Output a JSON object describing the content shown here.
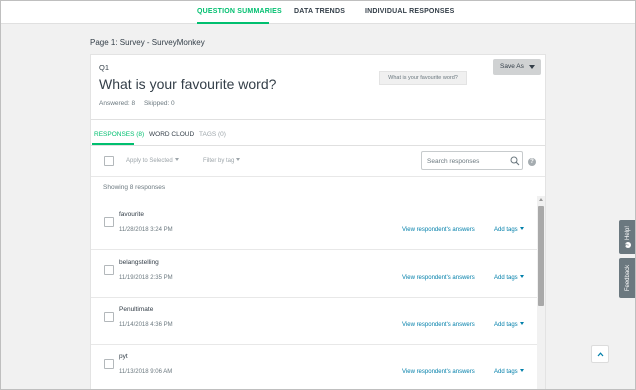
{
  "top_nav": {
    "tabs": [
      {
        "label": "QUESTION SUMMARIES",
        "active": true
      },
      {
        "label": "DATA TRENDS",
        "active": false
      },
      {
        "label": "INDIVIDUAL RESPONSES",
        "active": false
      }
    ]
  },
  "page": {
    "title": "Page 1: Survey - SurveyMonkey"
  },
  "question": {
    "number": "Q1",
    "title": "What is your favourite word?",
    "answered": "Answered: 8",
    "skipped": "Skipped: 0",
    "tooltip": "What is your favourite word?",
    "save_as_label": "Save As"
  },
  "subtabs": [
    {
      "label": "RESPONSES (8)",
      "state": "active"
    },
    {
      "label": "WORD CLOUD",
      "state": "normal"
    },
    {
      "label": "TAGS (0)",
      "state": "muted"
    }
  ],
  "toolbar": {
    "apply_label": "Apply to Selected",
    "filter_label": "Filter by tag",
    "search_placeholder": "Search responses",
    "help_glyph": "?"
  },
  "showing_text": "Showing 8 responses",
  "responses": [
    {
      "text": "favourite",
      "date": "11/28/2018 3:24 PM",
      "view_label": "View respondent's answers",
      "tags_label": "Add tags"
    },
    {
      "text": "belangstelling",
      "date": "11/19/2018 2:35 PM",
      "view_label": "View respondent's answers",
      "tags_label": "Add tags"
    },
    {
      "text": "Penultimate",
      "date": "11/14/2018 4:36 PM",
      "view_label": "View respondent's answers",
      "tags_label": "Add tags"
    },
    {
      "text": "pyt",
      "date": "11/13/2018 9:06 AM",
      "view_label": "View respondent's answers",
      "tags_label": "Add tags"
    }
  ],
  "side_tabs": {
    "help": "Help!",
    "feedback": "Feedback"
  },
  "colors": {
    "accent": "#00bf6f",
    "link": "#007faa",
    "text": "#333e48",
    "muted": "#6b787f"
  }
}
